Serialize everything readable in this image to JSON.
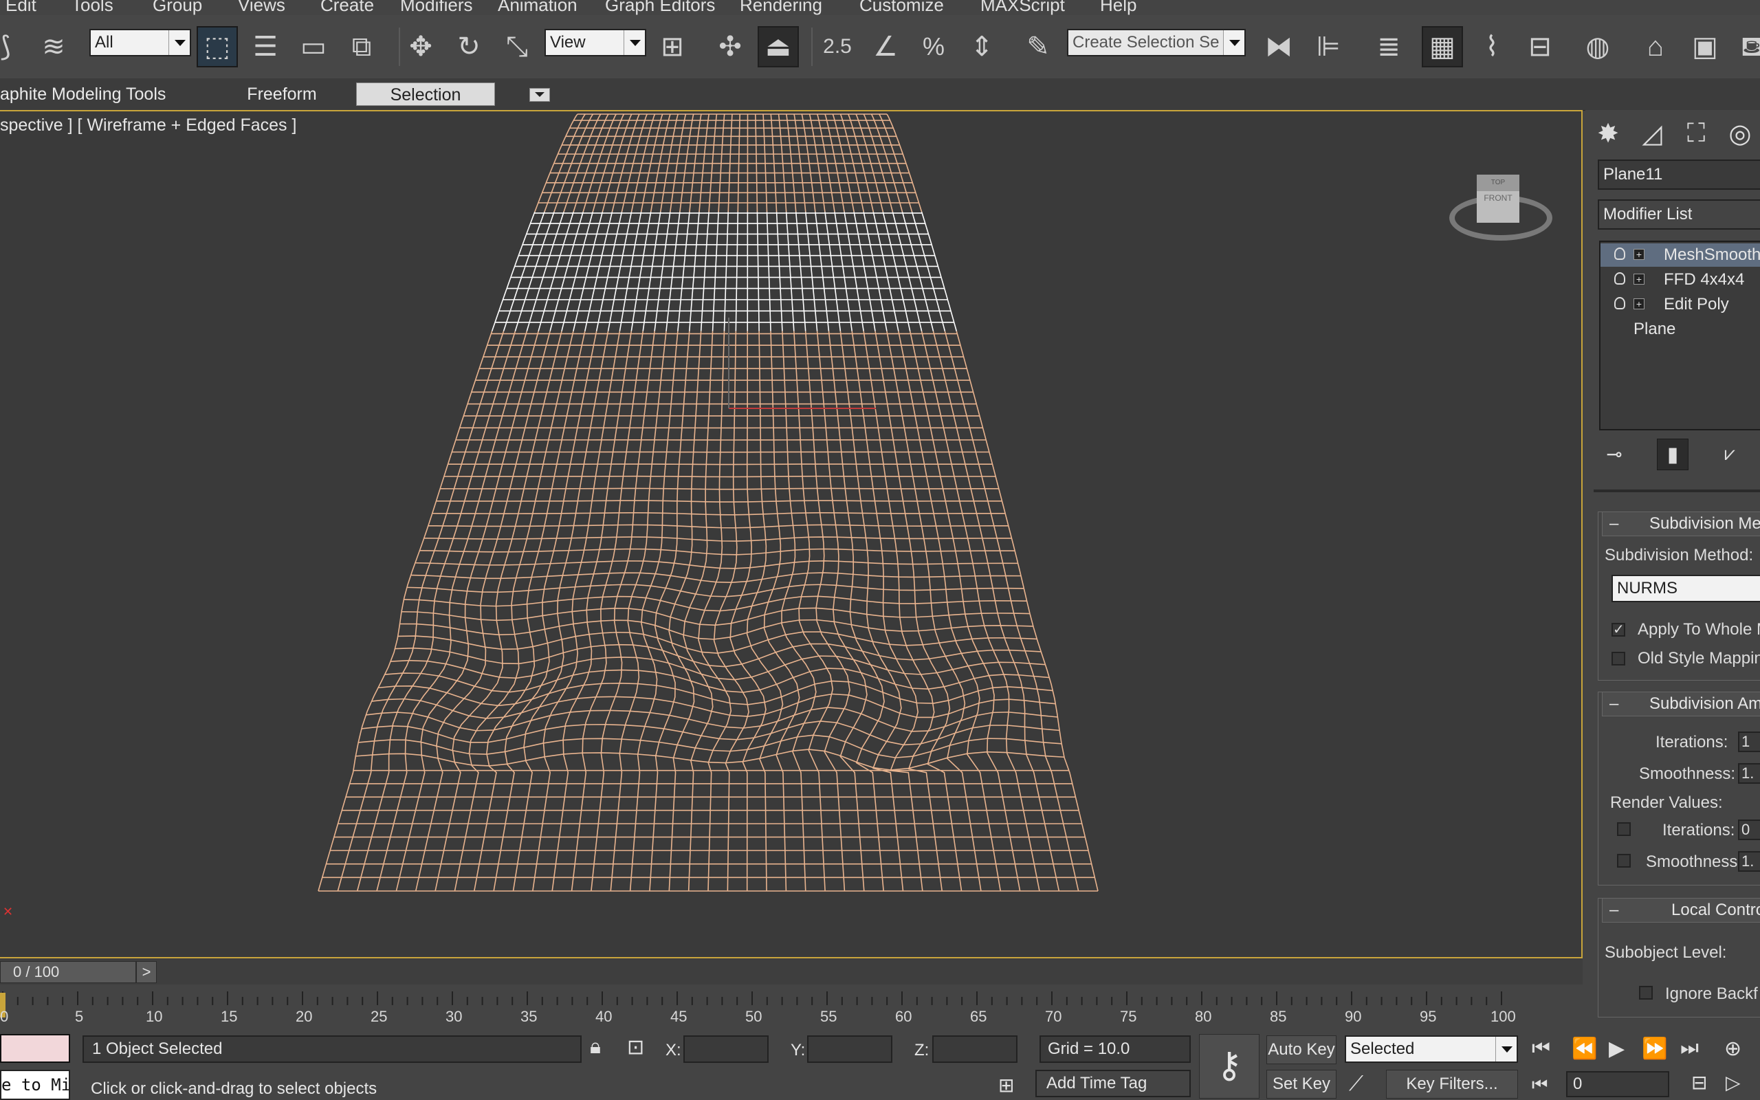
{
  "menu": [
    "Edit",
    "Tools",
    "Group",
    "Views",
    "Create",
    "Modifiers",
    "Animation",
    "Graph Editors",
    "Rendering",
    "Customize",
    "MAXScript",
    "Help"
  ],
  "toolbar": {
    "filter_value": "All",
    "refcoord_value": "View",
    "snap_angle_label": "2.5",
    "selection_set_placeholder": "Create Selection Se"
  },
  "ribbon": {
    "tabs": [
      "aphite Modeling Tools",
      "Freeform",
      "Selection"
    ]
  },
  "viewport": {
    "label": "spective ] [ Wireframe + Edged Faces ]",
    "viewcube_top": "TOP",
    "viewcube_front": "FRONT"
  },
  "command_panel": {
    "object_name": "Plane11",
    "modifier_list": "Modifier List",
    "stack": [
      "MeshSmooth",
      "FFD 4x4x4",
      "Edit Poly",
      "Plane"
    ],
    "rollout_subdivision_method": {
      "title": "Subdivision Met",
      "method_label": "Subdivision Method:",
      "method_value": "NURMS",
      "apply_whole": "Apply To Whole M",
      "old_style": "Old Style Mappin"
    },
    "rollout_subdivision_amount": {
      "title": "Subdivision Amo",
      "iterations_label": "Iterations:",
      "iterations_value": "1",
      "smoothness_label": "Smoothness:",
      "smoothness_value": "1.",
      "render_values_label": "Render Values:",
      "render_iterations_label": "Iterations:",
      "render_iterations_value": "0",
      "render_smoothness_label": "Smoothness:",
      "render_smoothness_value": "1."
    },
    "rollout_local_control": {
      "title": "Local Contro",
      "subobject_label": "Subobject Level:",
      "ignore_backface": "Ignore Backf"
    }
  },
  "time_slider": {
    "frame_label": "0 / 100",
    "next_label": ">"
  },
  "trackbar": {
    "ticks": [
      "0",
      "5",
      "10",
      "15",
      "20",
      "25",
      "30",
      "35",
      "40",
      "45",
      "50",
      "55",
      "60",
      "65",
      "70",
      "75",
      "80",
      "85",
      "90",
      "95",
      "100"
    ]
  },
  "status": {
    "maxscript_listener": "e to Mi",
    "selection_info": "1 Object Selected",
    "prompt": "Click or click-and-drag to select objects",
    "x_label": "X:",
    "y_label": "Y:",
    "z_label": "Z:",
    "grid": "Grid = 10.0",
    "add_time_tag": "Add Time Tag",
    "auto_key": "Auto Key",
    "set_key": "Set Key",
    "key_mode_value": "Selected",
    "key_filters": "Key Filters...",
    "current_frame": "0"
  },
  "colors": {
    "viewport_bg": "#3a3a3a",
    "wire_orange": "#e9b48f",
    "wire_white": "#ffffff",
    "viewport_border": "#c9a53b",
    "stack_selected": "#5f6d80"
  }
}
